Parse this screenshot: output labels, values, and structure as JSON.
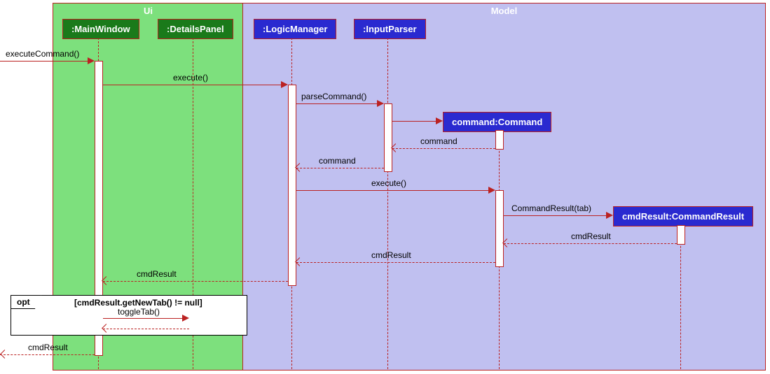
{
  "regions": {
    "ui": {
      "title": "Ui"
    },
    "model": {
      "title": "Model"
    }
  },
  "participants": {
    "mainwindow": ":MainWindow",
    "detailspanel": ":DetailsPanel",
    "logic": ":LogicManager",
    "parser": ":InputParser",
    "command": "command:Command",
    "cmdresult": "cmdResult:CommandResult"
  },
  "messages": {
    "m1": "executeCommand()",
    "m2": "execute()",
    "m3": "parseCommand()",
    "m4": "command",
    "m5": "command",
    "m6": "execute()",
    "m7": "CommandResult(tab)",
    "m8": "cmdResult",
    "m9": "cmdResult",
    "m10": "cmdResult",
    "m11": "toggleTab()",
    "m12": "cmdResult"
  },
  "opt": {
    "label": "opt",
    "guard": "[cmdResult.getNewTab() != null]"
  },
  "chart_data": {
    "type": "sequence_diagram",
    "regions": [
      {
        "name": "Ui",
        "participants": [
          ":MainWindow",
          ":DetailsPanel"
        ]
      },
      {
        "name": "Model",
        "participants": [
          ":LogicManager",
          ":InputParser",
          "command:Command",
          "cmdResult:CommandResult"
        ]
      }
    ],
    "participants": [
      ":MainWindow",
      ":DetailsPanel",
      ":LogicManager",
      ":InputParser",
      "command:Command",
      "cmdResult:CommandResult"
    ],
    "messages": [
      {
        "from": "external",
        "to": ":MainWindow",
        "label": "executeCommand()",
        "type": "sync"
      },
      {
        "from": ":MainWindow",
        "to": ":LogicManager",
        "label": "execute()",
        "type": "sync"
      },
      {
        "from": ":LogicManager",
        "to": ":InputParser",
        "label": "parseCommand()",
        "type": "sync"
      },
      {
        "from": ":InputParser",
        "to": "command:Command",
        "label": "",
        "type": "create"
      },
      {
        "from": "command:Command",
        "to": ":InputParser",
        "label": "command",
        "type": "return"
      },
      {
        "from": ":InputParser",
        "to": ":LogicManager",
        "label": "command",
        "type": "return"
      },
      {
        "from": ":LogicManager",
        "to": "command:Command",
        "label": "execute()",
        "type": "sync"
      },
      {
        "from": "command:Command",
        "to": "cmdResult:CommandResult",
        "label": "CommandResult(tab)",
        "type": "create"
      },
      {
        "from": "cmdResult:CommandResult",
        "to": "command:Command",
        "label": "cmdResult",
        "type": "return"
      },
      {
        "from": "command:Command",
        "to": ":LogicManager",
        "label": "cmdResult",
        "type": "return"
      },
      {
        "from": ":LogicManager",
        "to": ":MainWindow",
        "label": "cmdResult",
        "type": "return"
      },
      {
        "from": ":MainWindow",
        "to": ":DetailsPanel",
        "label": "toggleTab()",
        "type": "sync"
      },
      {
        "from": ":DetailsPanel",
        "to": ":MainWindow",
        "label": "",
        "type": "return"
      },
      {
        "from": ":MainWindow",
        "to": "external",
        "label": "cmdResult",
        "type": "return"
      }
    ],
    "fragments": [
      {
        "type": "opt",
        "guard": "[cmdResult.getNewTab() != null]",
        "covers": [
          ":MainWindow",
          ":DetailsPanel"
        ],
        "messages": [
          "toggleTab()"
        ]
      }
    ]
  }
}
